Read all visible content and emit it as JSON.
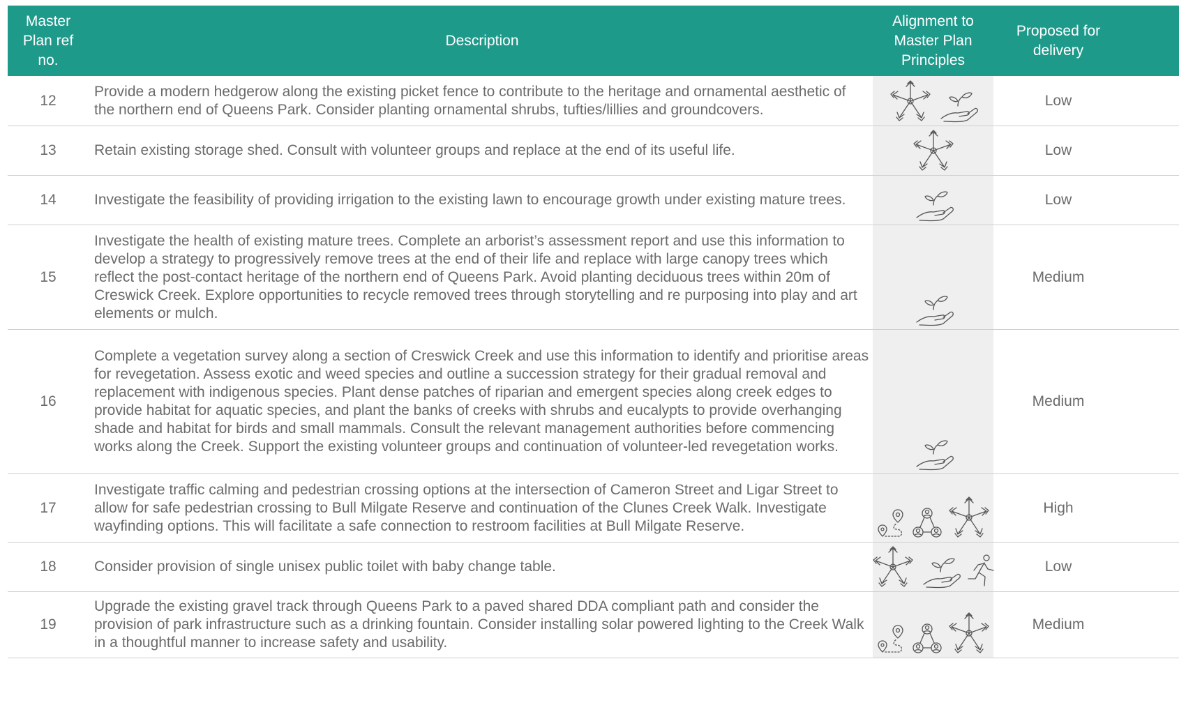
{
  "headers": {
    "ref": "Master\nPlan ref\nno.",
    "description": "Description",
    "alignment": "Alignment to\nMaster Plan\nPrinciples",
    "delivery": "Proposed for\ndelivery"
  },
  "rows": [
    {
      "ref": "12",
      "description": "Provide a modern hedgerow along the existing picket fence to contribute to the heritage and ornamental aesthetic of the northern end of Queens Park. Consider planting ornamental shrubs, tufties/lillies and groundcovers.",
      "icons": [
        "community-hands-icon",
        "plant-hand-icon"
      ],
      "delivery": "Low"
    },
    {
      "ref": "13",
      "description": "Retain existing storage shed. Consult with volunteer groups and replace at the end of its useful life.",
      "icons": [
        "community-hands-icon"
      ],
      "delivery": "Low"
    },
    {
      "ref": "14",
      "description": "Investigate the feasibility of providing irrigation to the existing lawn to encourage growth under existing mature trees.",
      "icons": [
        "plant-hand-icon"
      ],
      "delivery": "Low"
    },
    {
      "ref": "15",
      "description": "Investigate the health of existing mature trees. Complete an arborist’s assessment report and use this information to develop a strategy to progressively remove trees at the end of their life and replace with large canopy trees which reflect the post-contact heritage of the northern end of Queens Park. Avoid planting deciduous trees within 20m of Creswick Creek. Explore opportunities to recycle removed trees through storytelling and re purposing into play and art elements or mulch.",
      "icons": [
        "plant-hand-icon"
      ],
      "delivery": "Medium"
    },
    {
      "ref": "16",
      "description": "Complete a vegetation survey along a section of Creswick Creek and use this information to identify and prioritise areas for revegetation. Assess exotic and weed species and outline a succession strategy for their gradual removal and replacement with indigenous species. Plant dense patches of riparian and emergent species along creek edges to provide habitat for aquatic species, and plant the banks of creeks with shrubs and eucalypts to provide overhanging shade and habitat for birds and small mammals. Consult the relevant management authorities before commencing works along the Creek. Support the existing volunteer groups and continuation of volunteer-led revegetation works.",
      "icons": [
        "plant-hand-icon"
      ],
      "delivery": "Medium"
    },
    {
      "ref": "17",
      "description": "Investigate traffic calming and pedestrian crossing options at the intersection of Cameron Street and Ligar Street to allow for safe pedestrian crossing to Bull Milgate Reserve and continuation of the Clunes Creek Walk. Investigate wayfinding options. This will facilitate a safe connection to restroom facilities at Bull Milgate Reserve.",
      "icons": [
        "location-path-icon",
        "people-network-icon",
        "community-hands-icon"
      ],
      "delivery": "High"
    },
    {
      "ref": "18",
      "description": "Consider provision of single unisex public toilet with baby change table.",
      "icons": [
        "community-hands-icon",
        "plant-hand-icon",
        "runner-icon"
      ],
      "delivery": "Low"
    },
    {
      "ref": "19",
      "description": "Upgrade the existing gravel track through Queens Park to a paved shared DDA compliant path and consider the provision of park infrastructure such as a drinking fountain. Consider installing solar powered lighting to the Creek Walk in a thoughtful manner to increase safety and usability.",
      "icons": [
        "location-path-icon",
        "people-network-icon",
        "community-hands-icon"
      ],
      "delivery": "Medium"
    }
  ]
}
